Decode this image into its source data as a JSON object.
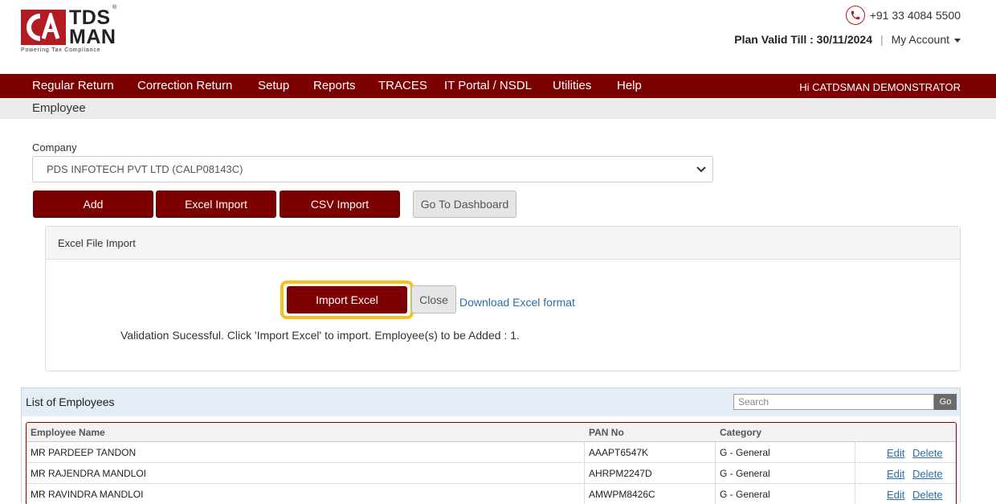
{
  "brand": {
    "name_line1": "TDS",
    "name_line2": "MAN",
    "tagline": "Powering Tax Compliance",
    "reg_mark": "®",
    "accent_color": "#b11b22",
    "nav_color": "#7d0000"
  },
  "header": {
    "phone": "+91 33 4084 5500",
    "plan_label": "Plan Valid Till : 30/11/2024",
    "separator": "|",
    "account_label": "My Account"
  },
  "nav": {
    "items": [
      "Regular Return",
      "Correction Return",
      "Setup",
      "Reports",
      "TRACES",
      "IT Portal / NSDL",
      "Utilities",
      "Help"
    ],
    "user_greeting": "Hi CATDSMAN DEMONSTRATOR"
  },
  "page": {
    "breadcrumb": "Employee"
  },
  "company": {
    "label": "Company",
    "selected": "PDS INFOTECH PVT LTD (CALP08143C)"
  },
  "actions": {
    "add": "Add",
    "excel_import": "Excel Import",
    "csv_import": "CSV Import",
    "dashboard": "Go To Dashboard"
  },
  "import_panel": {
    "title": "Excel File Import",
    "import_button": "Import Excel",
    "close_button": "Close",
    "download_link": "Download Excel format",
    "message": "Validation Sucessful. Click 'Import Excel' to import. Employee(s) to be Added : 1."
  },
  "employees": {
    "title": "List of Employees",
    "search_placeholder": "Search",
    "search_button": "Go",
    "columns": [
      "Employee Name",
      "PAN No",
      "Category"
    ],
    "rows": [
      {
        "name": "MR PARDEEP TANDON",
        "pan": "AAAPT6547K",
        "category": "G - General",
        "edit": "Edit",
        "delete": "Delete"
      },
      {
        "name": "MR RAJENDRA MANDLOI",
        "pan": "AHRPM2247D",
        "category": "G - General",
        "edit": "Edit",
        "delete": "Delete"
      },
      {
        "name": "MR RAVINDRA MANDLOI",
        "pan": "AMWPM8426C",
        "category": "G - General",
        "edit": "Edit",
        "delete": "Delete"
      }
    ]
  }
}
